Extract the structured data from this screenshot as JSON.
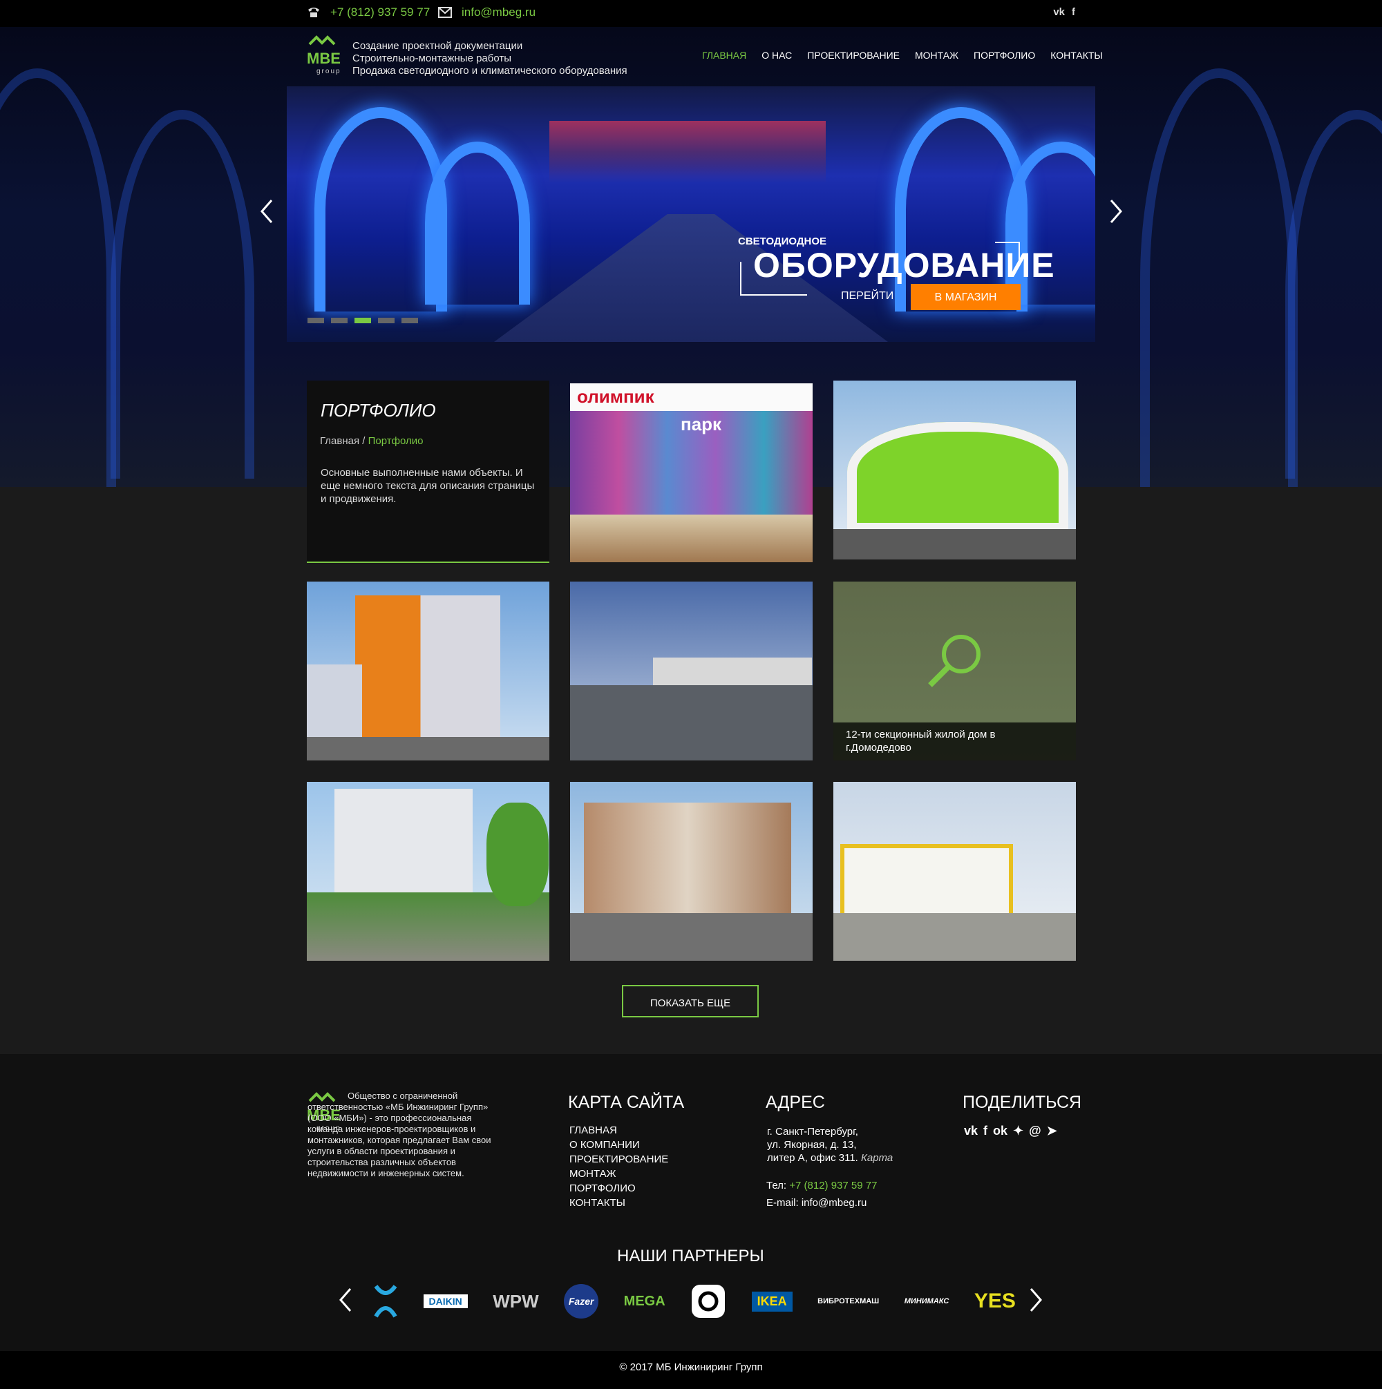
{
  "topbar": {
    "phone": "+7 (812) 937 59 77",
    "email": "info@mbeg.ru",
    "social": [
      "vk-icon",
      "facebook-icon"
    ]
  },
  "header": {
    "logo_text": "MBE",
    "logo_sub": "group",
    "tagline": [
      "Создание проектной документации",
      "Строительно-монтажные работы",
      "Продажа светодиодного и климатического оборудования"
    ],
    "nav": [
      "ГЛАВНАЯ",
      "О НАС",
      "ПРОЕКТИРОВАНИЕ",
      "МОНТАЖ",
      "ПОРТФОЛИО",
      "КОНТАКТЫ"
    ],
    "nav_active": 0
  },
  "slider": {
    "small_title": "СВЕТОДИОДНОЕ",
    "big_title": "ОБОРУДОВАНИЕ",
    "go_label": "ПЕРЕЙТИ",
    "shop_label": "В МАГАЗИН",
    "dots": 5,
    "active_dot": 3
  },
  "portfolio": {
    "title": "ПОРТФОЛИО",
    "crumb_home": "Главная",
    "crumb_sep": "/",
    "crumb_current": "Портфолио",
    "description": "Основные выполненные нами объекты. И еще немного текста для описания страницы и продвижения.",
    "tile1_sign_a": "олимпик",
    "tile1_sign_b": "парк",
    "hover_caption": "12-ти секционный жилой дом в г.Домодедово",
    "more_label": "ПОКАЗАТЬ ЕЩЕ"
  },
  "footer": {
    "about": "Общество с ограниченной ответственностью «МБ Инжиниринг Групп» (ООО «МБИ») - это профессиональная команда инженеров-проектировщиков и монтажников, которая предлагает Вам свои услуги в области проектирования и строительства различных объектов недвижимости и инженерных систем.",
    "sitemap_title": "КАРТА САЙТА",
    "sitemap": [
      "ГЛАВНАЯ",
      "О КОМПАНИИ",
      "ПРОЕКТИРОВАНИЕ",
      "МОНТАЖ",
      "ПОРТФОЛИО",
      "КОНТАКТЫ"
    ],
    "address_title": "АДРЕС",
    "address_lines": [
      "г. Санкт-Петербург,",
      "ул. Якорная, д. 13,",
      "литер А, офис 311."
    ],
    "map_link": "Карта",
    "tel_label": "Тел:",
    "tel": "+7 (812) 937 59 77",
    "email_label": "E-mail:",
    "email": "info@mbeg.ru",
    "share_title": "ПОДЕЛИТЬСЯ",
    "share_icons": [
      "vk-icon",
      "facebook-icon",
      "odnoklassniki-icon",
      "twitter-icon",
      "mail-icon",
      "pin-icon"
    ],
    "partners_title": "НАШИ ПАРТНЕРЫ",
    "partners": [
      "DAIKIN",
      "WPW",
      "Fazer",
      "MEGA",
      "IKEA",
      "ВИБРОТЕХМАШ",
      "МИНИМАКС",
      "YES"
    ],
    "copyright": "© 2017 МБ Инжиниринг Групп"
  },
  "colors": {
    "accent": "#7ac943",
    "shop": "#ff7f00",
    "bg": "#1b1b1b"
  }
}
